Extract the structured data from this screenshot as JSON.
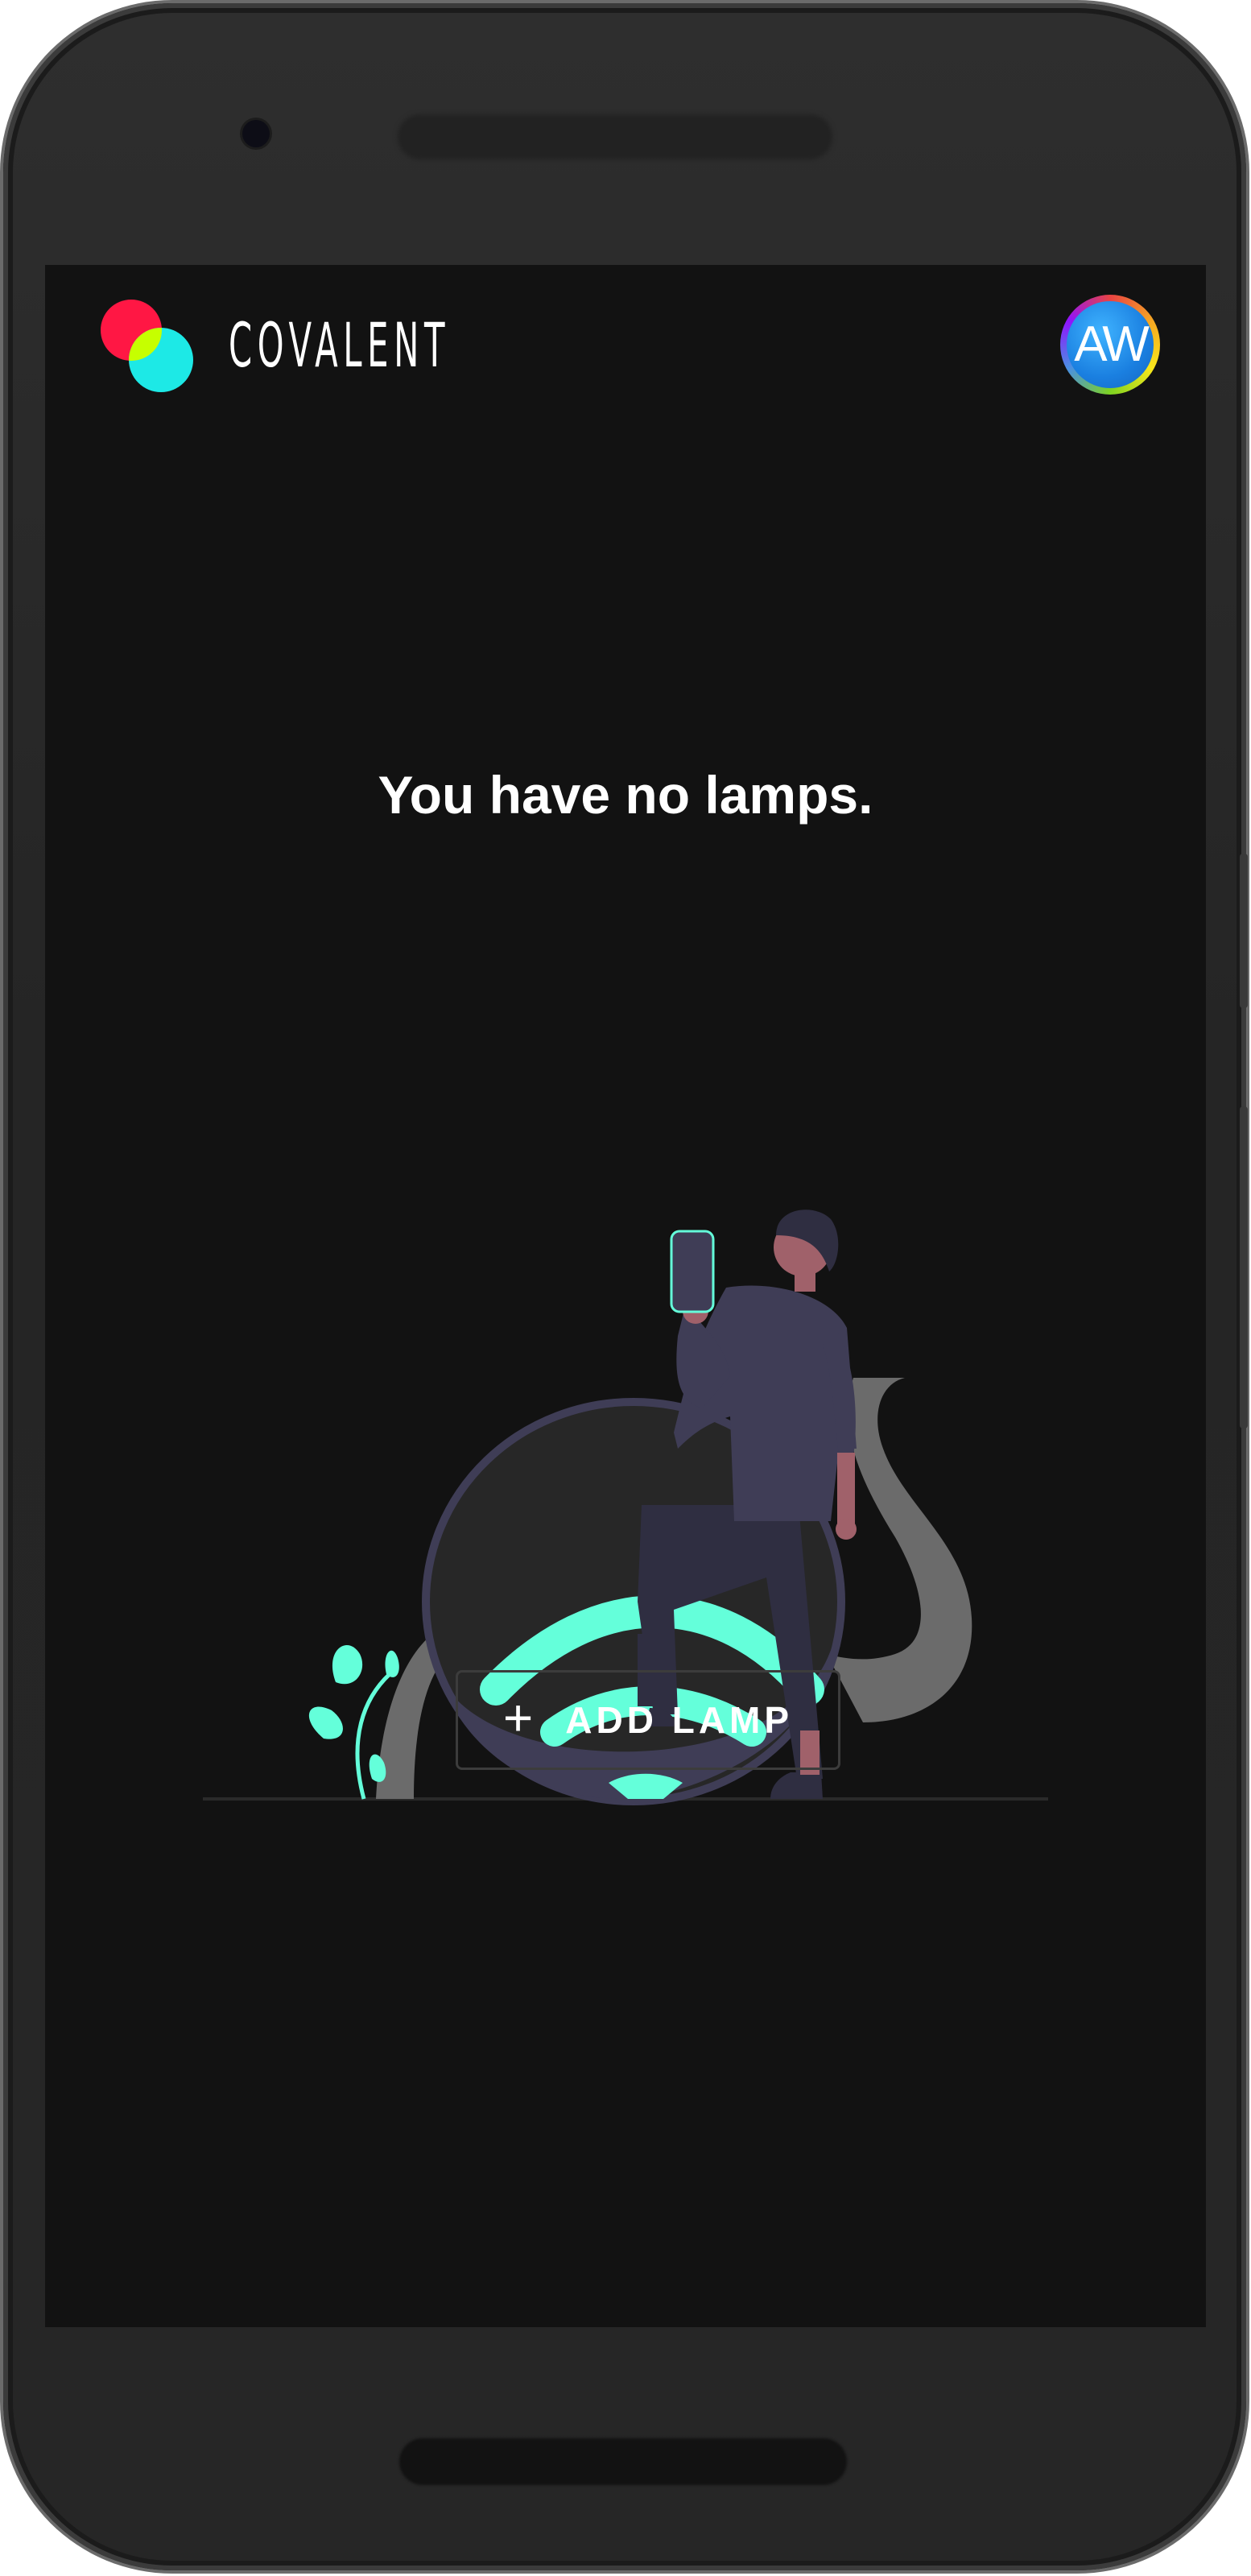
{
  "app": {
    "brand_name": "COVALENT",
    "logo_icon": "covalent-overlapping-circles-icon",
    "brand_colors": {
      "red": "#ff1744",
      "cyan": "#1de9e6",
      "yellow_green": "#c6ff00"
    }
  },
  "header": {
    "avatar_initials": "AW"
  },
  "empty_state": {
    "title": "You have no lamps.",
    "illustration": "person-with-phone-and-wifi-lamp-illustration",
    "accent_color": "#64ffda"
  },
  "actions": {
    "add_button_icon": "plus-icon",
    "add_button_label": "ADD LAMP"
  },
  "theme": {
    "screen_background": "#121212",
    "button_border": "#3c3c3c"
  }
}
